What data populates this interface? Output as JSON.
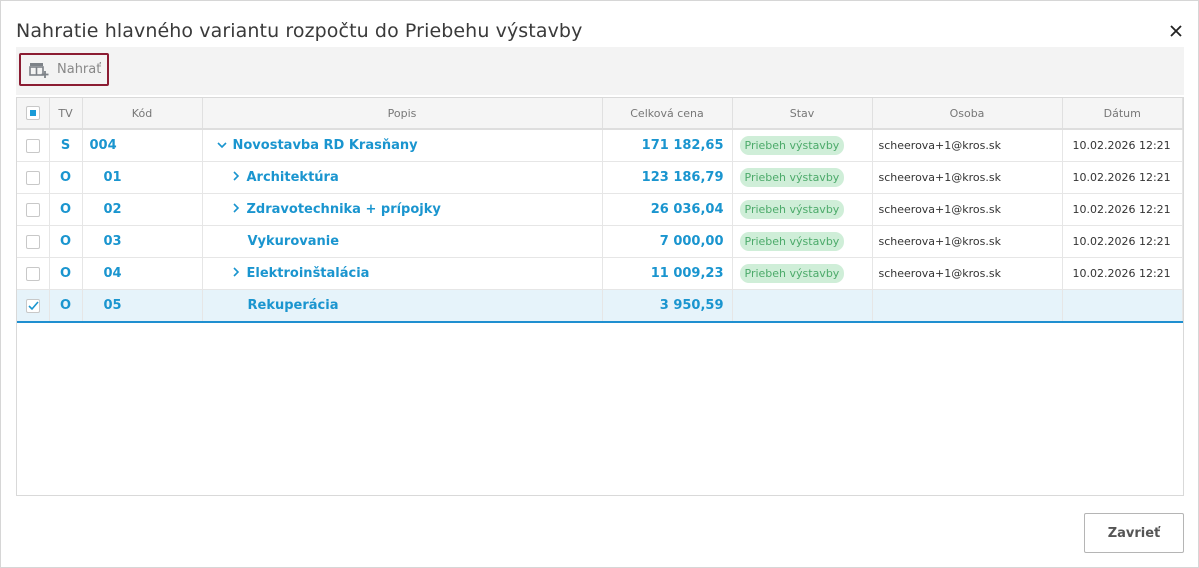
{
  "dialog": {
    "title": "Nahratie hlavného variantu rozpočtu do Priebehu výstavby",
    "close_icon": "close-icon"
  },
  "toolbar": {
    "load_label": "Nahrať",
    "load_icon": "table-add-icon"
  },
  "table": {
    "columns": [
      "TV",
      "Kód",
      "Popis",
      "Celková cena",
      "Stav",
      "Osoba",
      "Dátum"
    ],
    "rows": [
      {
        "checked": false,
        "tv": "S",
        "code": "004",
        "description": "Novostavba RD Krasňany",
        "expander": "chevron-down-icon",
        "level": 0,
        "price": "171 182,65",
        "status": "Priebeh výstavby",
        "person": "scheerova+1@kros.sk",
        "date": "10.02.2026 12:21"
      },
      {
        "checked": false,
        "tv": "O",
        "code": "01",
        "description": "Architektúra",
        "expander": "chevron-right-icon",
        "level": 1,
        "price": "123 186,79",
        "status": "Priebeh výstavby",
        "person": "scheerova+1@kros.sk",
        "date": "10.02.2026 12:21"
      },
      {
        "checked": false,
        "tv": "O",
        "code": "02",
        "description": "Zdravotechnika + prípojky",
        "expander": "chevron-right-icon",
        "level": 1,
        "price": "26 036,04",
        "status": "Priebeh výstavby",
        "person": "scheerova+1@kros.sk",
        "date": "10.02.2026 12:21"
      },
      {
        "checked": false,
        "tv": "O",
        "code": "03",
        "description": "Vykurovanie",
        "expander": "",
        "level": 1,
        "price": "7 000,00",
        "status": "Priebeh výstavby",
        "person": "scheerova+1@kros.sk",
        "date": "10.02.2026 12:21"
      },
      {
        "checked": false,
        "tv": "O",
        "code": "04",
        "description": "Elektroinštalácia",
        "expander": "chevron-right-icon",
        "level": 1,
        "price": "11 009,23",
        "status": "Priebeh výstavby",
        "person": "scheerova+1@kros.sk",
        "date": "10.02.2026 12:21"
      },
      {
        "checked": true,
        "tv": "O",
        "code": "05",
        "description": "Rekuperácia",
        "expander": "",
        "level": 1,
        "price": "3 950,59",
        "status": "",
        "person": "",
        "date": ""
      }
    ]
  },
  "footer": {
    "close_label": "Zavrieť"
  },
  "colors": {
    "accent_blue": "#1a95cf",
    "selected_row": "#e6f3fa",
    "badge_bg": "#cfeed8",
    "badge_text": "#4caa6a",
    "focus_border": "#8b1c32"
  }
}
